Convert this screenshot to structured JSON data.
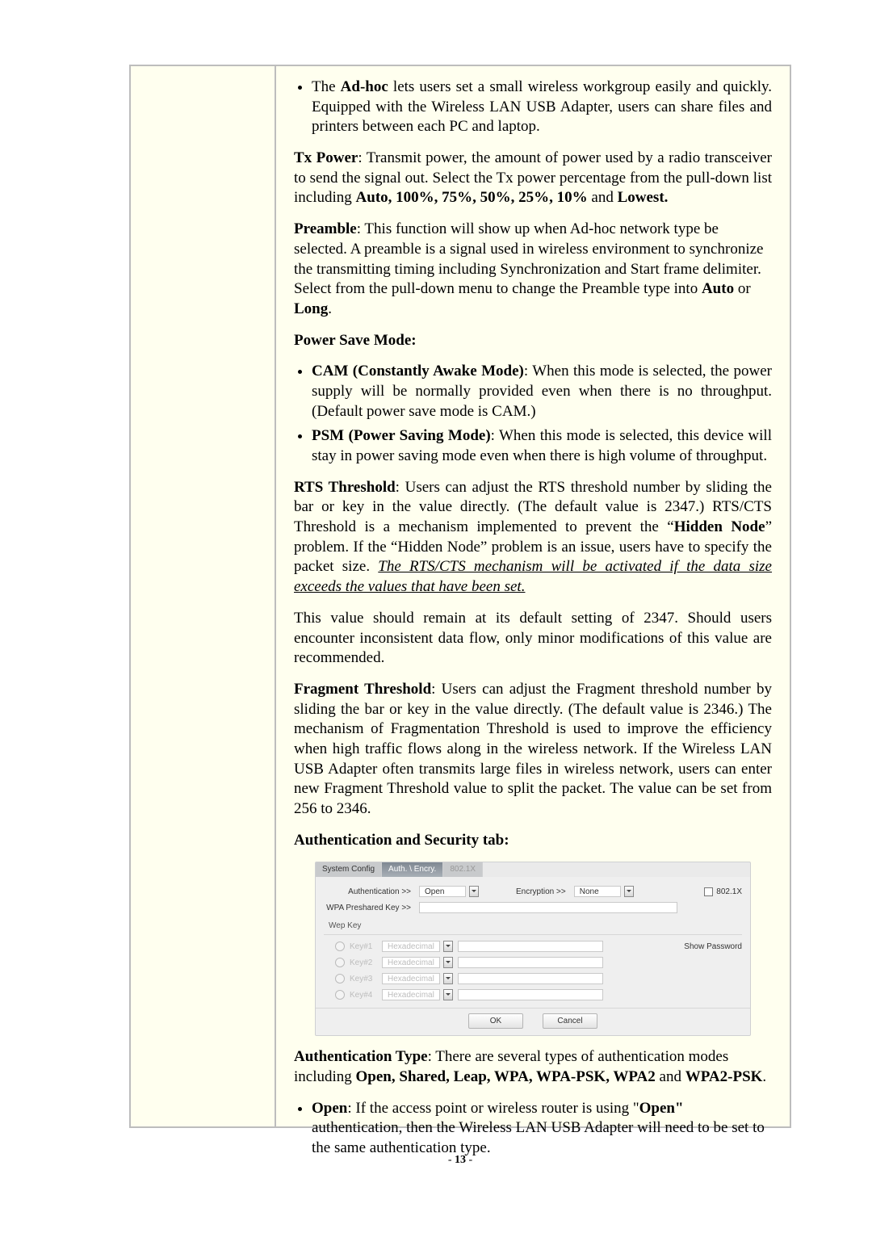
{
  "page": {
    "number": "13"
  },
  "body": {
    "adhoc_li": "The <b>Ad-hoc</b> lets users set a small wireless workgroup easily and quickly. Equipped with the Wireless LAN USB Adapter, users can share files and printers between each PC and laptop.",
    "txpower": "<span class=\"b\">Tx Power</span>: Transmit power, the amount of power used by a radio transceiver to send the signal out. Select the Tx power percentage from the pull-down list including <span class=\"b\">Auto, 100%, 75%, 50%, 25%, 10%</span> and <span class=\"b\">Lowest.</span>",
    "preamble": "<span class=\"b\">Preamble</span>: This function will show up when Ad-hoc network type be selected. A preamble is a signal used in wireless environment to synchronize the transmitting timing including Synchronization and Start frame delimiter. Select from the pull-down menu to change the Preamble type into <span class=\"b\">Auto</span> or <span class=\"b\">Long</span>.",
    "psm_header": "Power Save Mode",
    "psm_cam": "<span class=\"b\">CAM (Constantly Awake Mode)</span>: When this mode is selected, the power supply will be normally provided even when there is no throughput. (Default power save mode is CAM.)",
    "psm_psm": "<span class=\"b\">PSM (Power Saving Mode)</span>: When this mode is selected, this device will stay in power saving mode even when there is high volume of throughput.",
    "rts1": "<span class=\"b\">RTS Threshold</span>: Users can adjust the RTS threshold number by sliding the bar or key in the value directly. (The default value is 2347.) RTS/CTS Threshold is a mechanism implemented to prevent the &ldquo;<span class=\"b\">Hidden Node</span>&rdquo; problem. If the &ldquo;Hidden Node&rdquo; problem is an issue, users have to specify the packet size. <span class=\"i u\">The RTS/CTS mechanism will be activated if the data size exceeds the values that have been set.</span>",
    "rts2": "This value should remain at its default setting of 2347. Should users encounter inconsistent data flow, only minor modifications of this value are recommended.",
    "frag": "<span class=\"b\">Fragment Threshold</span>: Users can adjust the Fragment threshold number by sliding the bar or key in the value directly. (The default value is 2346.) The mechanism of Fragmentation Threshold is used to improve the efficiency when high traffic flows along in the wireless network. If the Wireless LAN USB Adapter often transmits large files in wireless network, users can enter new Fragment Threshold value to split the packet. The value can be set from 256 to 2346.",
    "auth_title": "Authentication and Security tab:",
    "auth_type": "<span class=\"b\">Authentication Type</span>: There are several types of authentication modes including <span class=\"b\">Open, Shared, Leap, WPA, WPA-PSK, WPA2</span> and <span class=\"b\">WPA2-PSK</span>.",
    "open_li": "<span class=\"b\">Open</span>: If the access point or wireless router is using &quot;<span class=\"b\">Open&quot;</span> authentication, then the Wireless LAN USB Adapter will need to be set to the same authentication type."
  },
  "ui": {
    "tabs": {
      "system": "System Config",
      "auth": "Auth. \\ Encry.",
      "dot1x": "802.1X"
    },
    "auth_lbl": "Authentication >>",
    "auth_val": "Open",
    "enc_lbl": "Encryption >>",
    "enc_val": "None",
    "dot1x_chk": "802.1X",
    "wpa_lbl": "WPA Preshared Key >>",
    "wep_title": "Wep Key",
    "keys": [
      {
        "name": "Key#1",
        "mode": "Hexadecimal"
      },
      {
        "name": "Key#2",
        "mode": "Hexadecimal"
      },
      {
        "name": "Key#3",
        "mode": "Hexadecimal"
      },
      {
        "name": "Key#4",
        "mode": "Hexadecimal"
      }
    ],
    "show_pw": "Show Password",
    "ok": "OK",
    "cancel": "Cancel"
  }
}
